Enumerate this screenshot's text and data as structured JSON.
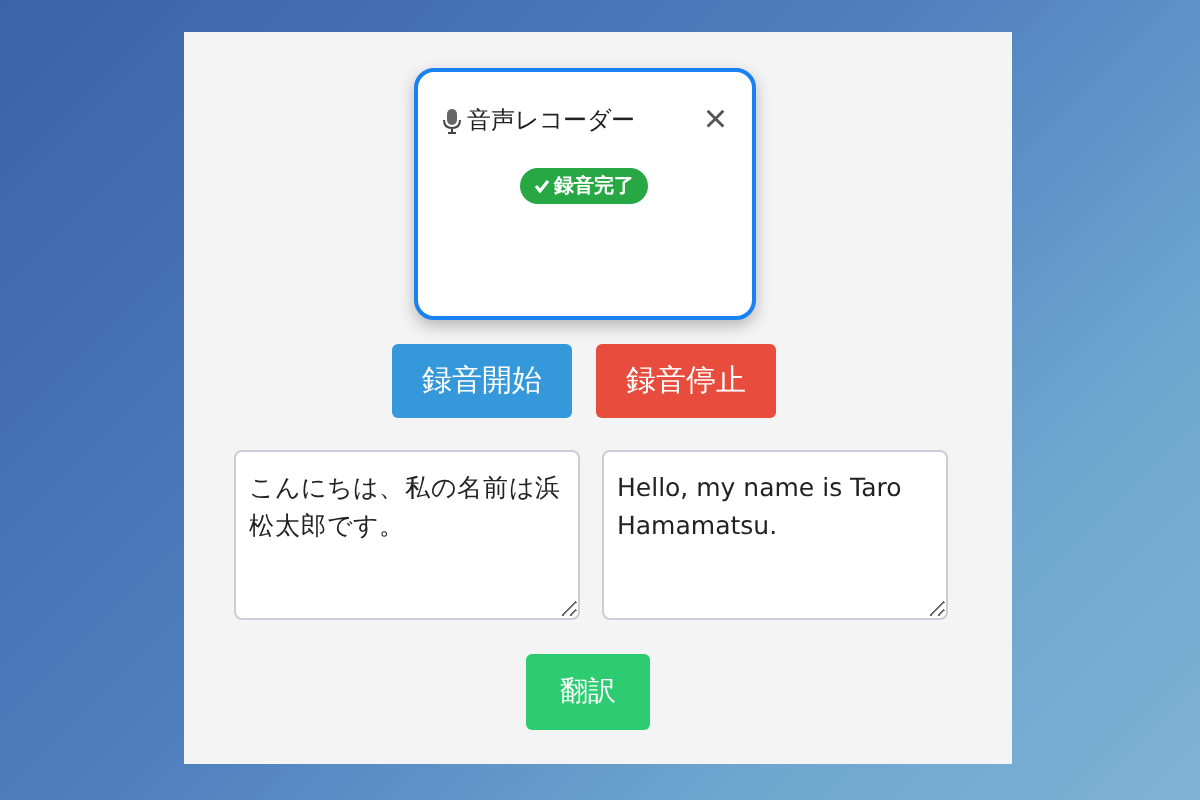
{
  "dialog": {
    "title": "音声レコーダー",
    "close": "×",
    "status": {
      "label": "録音完了",
      "done": true
    }
  },
  "buttons": [
    {
      "label": "録音開始",
      "kind": "start"
    },
    {
      "label": "録音停止",
      "kind": "stop"
    }
  ],
  "source_text": {
    "value": "こんにちは、私の名前は浜松太郎です。"
  },
  "translated_text": {
    "value": "Hello, my name is Taro Hamamatsu."
  },
  "translate_button": {
    "label": "翻訳"
  }
}
